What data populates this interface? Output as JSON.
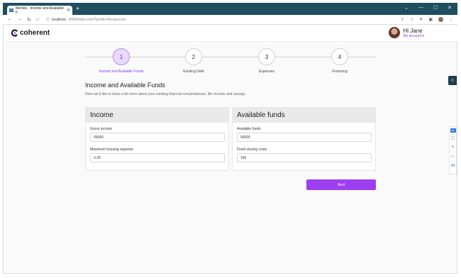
{
  "browser": {
    "tab_title": "Mendix - Income and Available F",
    "tab_favicon": "mx",
    "tab_close": "✕",
    "new_tab": "+",
    "url_host": "localhost",
    "url_rest": ":8080/index.html?profile=Responsive",
    "window_controls": {
      "minimize": "⌄",
      "restore": "—",
      "maximize": "☐",
      "close": "✕"
    }
  },
  "header": {
    "logo_text": "coherent",
    "greeting": "Hi Jane",
    "account_menu": "My account ▾"
  },
  "stepper": {
    "steps": [
      {
        "number": "1",
        "label": "Income and Available Funds",
        "active": true
      },
      {
        "number": "2",
        "label": "Existing Debt",
        "active": false
      },
      {
        "number": "3",
        "label": "Expenses",
        "active": false
      },
      {
        "number": "4",
        "label": "Financing",
        "active": false
      }
    ]
  },
  "page": {
    "title": "Income and Available Funds",
    "subtitle": "Here we'd like to know a bit more about your existing financial circumstances, like income and savings."
  },
  "income": {
    "heading": "Income",
    "gross_income_label": "Gross income",
    "gross_income_value": "65060",
    "max_housing_label": "Maximum housing expense",
    "max_housing_value": "0.28"
  },
  "funds": {
    "heading": "Available funds",
    "available_label": "Available funds",
    "available_value": "56000",
    "closing_label": "Fixed closing costs",
    "closing_value": "150"
  },
  "actions": {
    "next_label": "Next"
  },
  "rail": {
    "badge": "IDE"
  },
  "colors": {
    "accent": "#9d3ef0",
    "chrome": "#1f4e5f",
    "active_step": "#ead9fb"
  }
}
